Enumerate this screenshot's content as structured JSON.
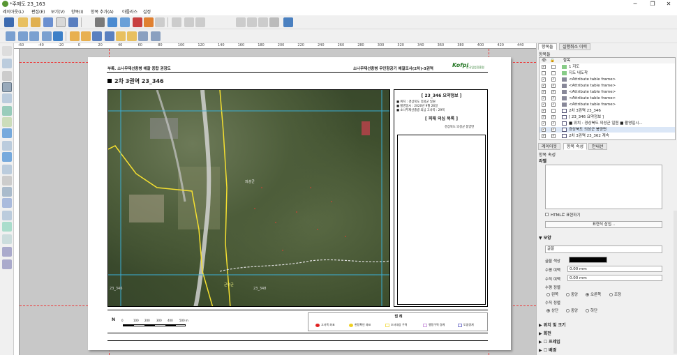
{
  "window": {
    "title": "*주제도 23_163",
    "min_icon": "minimize-icon",
    "restore_icon": "restore-icon",
    "close_icon": "close-icon"
  },
  "menu": [
    "레이아웃(L)",
    "편집(E)",
    "보기(V)",
    "항목(I)",
    "항목 추가(A)",
    "아틀라스",
    "설정"
  ],
  "toolbar": {
    "page_value": "1"
  },
  "ruler": {
    "ticks": [
      "-60",
      "-40",
      "-20",
      "0",
      "20",
      "40",
      "60",
      "80",
      "100",
      "120",
      "140",
      "160",
      "180",
      "200",
      "220",
      "240",
      "260",
      "280",
      "300",
      "320",
      "340",
      "360",
      "380",
      "400",
      "420",
      "440"
    ]
  },
  "layout": {
    "header_left": "부록. 소나무재선충병 예찰 종합 권장도",
    "header_right": "소나무재선충병 무인항공기 예찰조사(2차)-3권역",
    "logo": "Kofpi",
    "logo_sub": "한국임업진흥원",
    "area_title": "2차 3권역  23_346",
    "map_labels": {
      "village": "의성군",
      "town": "군위군",
      "grid_a": "23_346",
      "grid_b": "23_348"
    },
    "summary_title": "[ 23_346 요약정보 ]",
    "summary_items": [
      "■ 위치 : 경상북도 의성군 일원",
      "■ 촬영일시 : 2020년 9월 26일",
      "■ 소나무재선충병 의심 고사목 : 29목"
    ],
    "suspect_title": "[ 피해 의심 목록 ]",
    "suspect_sub": "경상북도 의성군 봉양면",
    "legend_title": "범  례",
    "legend_items": [
      {
        "label": "고사목 좌표",
        "color": "#e02020"
      },
      {
        "label": "현장확인 좌표",
        "color": "#f0d020"
      },
      {
        "label": "조사대상 구역",
        "color": "#f4e060"
      },
      {
        "label": "행정구역 경계",
        "color": "#d0a0e0"
      },
      {
        "label": "도엽경계",
        "color": "#8080d0"
      }
    ],
    "north": "N",
    "scale_labels": [
      "0",
      "100",
      "200",
      "300",
      "400",
      "500 m"
    ]
  },
  "dock": {
    "tabs": [
      "항목들",
      "실행취소 이력"
    ],
    "items_section": "항목들",
    "item_header": "항목",
    "items": [
      {
        "label": "1 지도",
        "vis": true,
        "lock": false,
        "icon": "map-icon"
      },
      {
        "label": "지도 내도착",
        "vis": false,
        "lock": false,
        "icon": "map-icon"
      },
      {
        "label": "<Attribute table frame>",
        "vis": true,
        "lock": true,
        "icon": "table-icon"
      },
      {
        "label": "<Attribute table frame>",
        "vis": true,
        "lock": true,
        "icon": "table-icon"
      },
      {
        "label": "<Attribute table frame>",
        "vis": true,
        "lock": true,
        "icon": "table-icon"
      },
      {
        "label": "<Attribute table frame>",
        "vis": true,
        "lock": true,
        "icon": "table-icon"
      },
      {
        "label": "<Attribute table frame>",
        "vis": true,
        "lock": true,
        "icon": "table-icon"
      },
      {
        "label": "2차 3권역 23_346",
        "vis": true,
        "lock": false,
        "icon": "text-icon"
      },
      {
        "label": "[ 23_346 요약정보 ]",
        "vis": true,
        "lock": true,
        "icon": "text-icon"
      },
      {
        "label": "■ 위치 : 경상북도 의성군 일원 ■ 촬영일시...",
        "vis": true,
        "lock": true,
        "icon": "text-icon"
      },
      {
        "label": "경상북도 의성군 봉양면",
        "vis": true,
        "lock": true,
        "icon": "text-icon",
        "selected": true
      },
      {
        "label": "2차 3권역 23_362 계속",
        "vis": true,
        "lock": true,
        "icon": "text-icon"
      }
    ],
    "lower_tabs": [
      "레이아웃",
      "항목 속성",
      "안내선"
    ],
    "props_title": "항목 속성",
    "label_section": "라벨",
    "html_check": "HTML로 표현하기",
    "insert_expr": "표현식 삽입...",
    "appearance": "모양",
    "font_value": "글꼴",
    "font_color_label": "글꼴 색상",
    "font_color": "#000000",
    "h_margin_label": "수평 여백",
    "h_margin_value": "0.00 mm",
    "v_margin_label": "수직 여백",
    "v_margin_value": "0.00 mm",
    "h_align_label": "수평 정렬",
    "h_align_options": [
      "왼쪽",
      "중앙",
      "오른쪽",
      "조정"
    ],
    "h_align_selected": 2,
    "v_align_label": "수직 정렬",
    "v_align_options": [
      "상단",
      "중앙",
      "하단"
    ],
    "v_align_selected": 0,
    "position_size": "위치 및 크기",
    "rotation": "회전",
    "frame": "프레임",
    "background": "배경"
  }
}
